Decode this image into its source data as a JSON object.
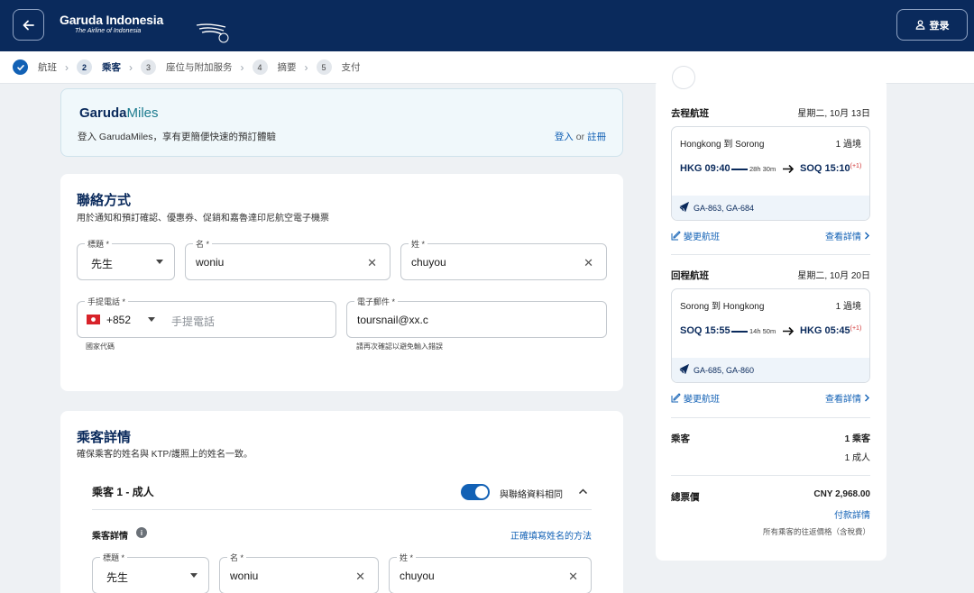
{
  "header": {
    "brand": "Garuda Indonesia",
    "tagline": "The Airline of Indonesia",
    "login_label": "登录"
  },
  "stepper": {
    "steps": [
      {
        "num": "",
        "label": "航班",
        "state": "done"
      },
      {
        "num": "2",
        "label": "乘客",
        "state": "active"
      },
      {
        "num": "3",
        "label": "座位与附加服务",
        "state": "pending"
      },
      {
        "num": "4",
        "label": "摘要",
        "state": "pending"
      },
      {
        "num": "5",
        "label": "支付",
        "state": "pending"
      }
    ]
  },
  "miles": {
    "logo_a": "Garuda",
    "logo_b": "Miles",
    "text": "登入 GarudaMiles，享有更簡便快速的預訂體驗",
    "login_link": "登入",
    "or": "or",
    "register_link": "註冊"
  },
  "contact": {
    "title": "聯絡方式",
    "subtitle": "用於通知和預訂確認、優惠券、促銷和嘉魯達印尼航空電子機票",
    "title_field": {
      "label": "標題 *",
      "value": "先生"
    },
    "first_name": {
      "label": "名 *",
      "value": "woniu"
    },
    "last_name": {
      "label": "姓 *",
      "value": "chuyou"
    },
    "phone": {
      "label": "手提電話 *",
      "code": "+852",
      "placeholder": "手提電話",
      "hint": "國家代碼"
    },
    "email": {
      "label": "電子郵件 *",
      "value": "toursnail@xx.c",
      "hint": "請再次確認以避免輸入錯誤"
    }
  },
  "passenger": {
    "title": "乘客詳情",
    "subtitle": "確保乘客的姓名與 KTP/護照上的姓名一致。",
    "pax_title": "乘客 1 - 成人",
    "same_as_contact": "與聯絡資料相同",
    "details_label": "乘客詳情",
    "name_help_link": "正確填寫姓名的方法",
    "title_field": {
      "label": "標題 *",
      "value": "先生"
    },
    "first_name": {
      "label": "名 *",
      "value": "woniu"
    },
    "last_name": {
      "label": "姓 *",
      "value": "chuyou"
    }
  },
  "summary": {
    "outbound": {
      "label": "去程航班",
      "date": "星期二, 10月 13日",
      "route": "Hongkong 到 Sorong",
      "type": "1 過境",
      "dep": "HKG 09:40",
      "duration": "28h 30m",
      "arr": "SOQ 15:10",
      "plus": "(+1)",
      "codes": "GA-863, GA-684",
      "change": "變更航班",
      "details": "查看詳情"
    },
    "inbound": {
      "label": "回程航班",
      "date": "星期二, 10月 20日",
      "route": "Sorong 到 Hongkong",
      "type": "1 過境",
      "dep": "SOQ 15:55",
      "duration": "14h 50m",
      "arr": "HKG 05:45",
      "plus": "(+1)",
      "codes": "GA-685, GA-860",
      "change": "變更航班",
      "details": "查看詳情"
    },
    "passengers_label": "乘客",
    "passengers_count": "1 乘客",
    "passengers_detail": "1 成人",
    "total_label": "總票價",
    "total_value": "CNY 2,968.00",
    "payment_details": "付款詳情",
    "total_note": "所有乘客的往返價格（含稅費）"
  },
  "colors": {
    "header_bg": "#0a2a5c",
    "accent": "#1261b5"
  }
}
